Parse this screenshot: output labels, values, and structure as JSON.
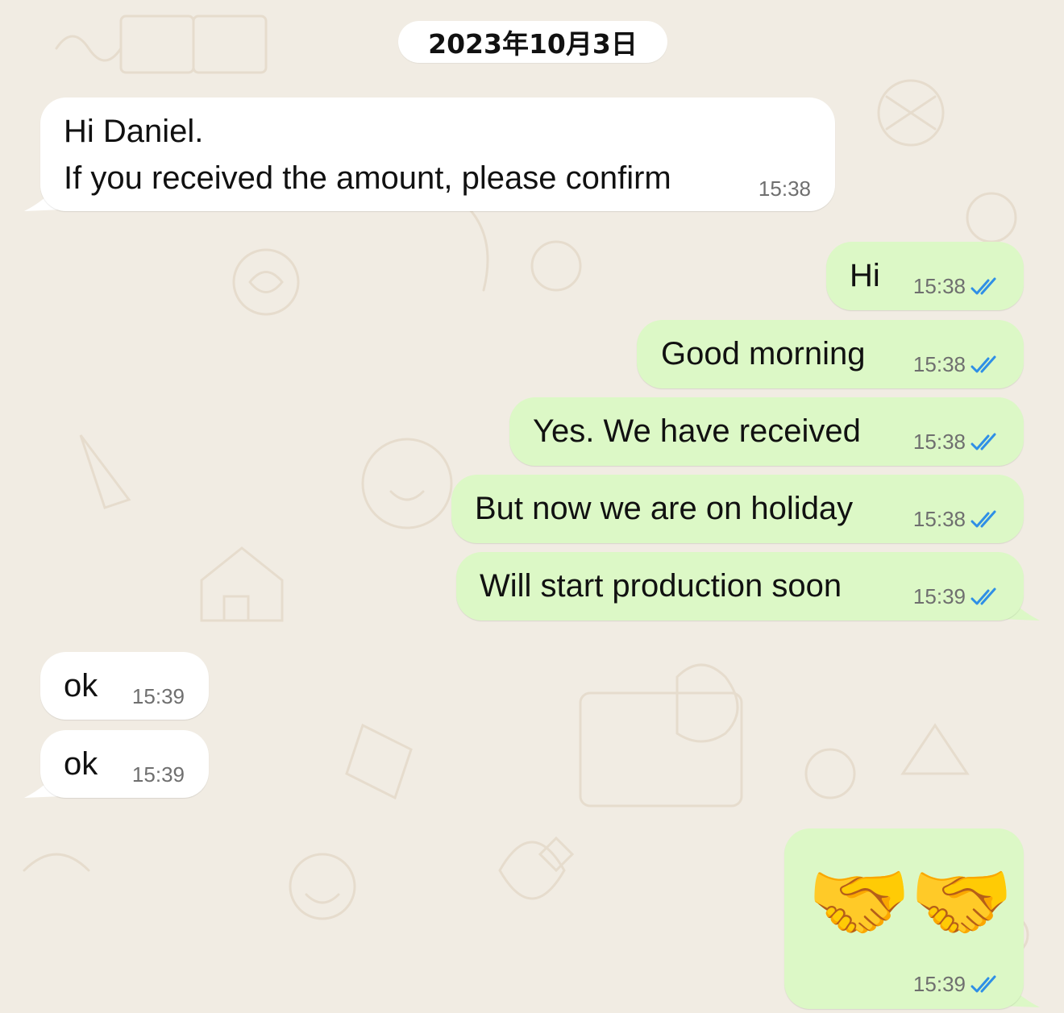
{
  "date_separator": "2023年10月3日",
  "messages": [
    {
      "lines": [
        "Hi Daniel.",
        "If you received the amount, please confirm"
      ],
      "time": "15:38"
    },
    {
      "text": "Hi",
      "time": "15:38"
    },
    {
      "text": "Good morning",
      "time": "15:38"
    },
    {
      "text": "Yes. We have received",
      "time": "15:38"
    },
    {
      "text": "But now we are on holiday",
      "time": "15:38"
    },
    {
      "text": "Will start production soon",
      "time": "15:39"
    },
    {
      "text": "ok",
      "time": "15:39"
    },
    {
      "text": "ok",
      "time": "15:39"
    },
    {
      "emojis": [
        "🤝",
        "🤝"
      ],
      "time": "15:39"
    }
  ],
  "colors": {
    "wallpaper": "#f1ece3",
    "incoming_bubble": "#ffffff",
    "outgoing_bubble": "#dcf8c6",
    "read_ticks": "#2f8fe6",
    "timestamp": "#6f6f6f"
  },
  "icons": {
    "read_receipt": "double-check-icon"
  }
}
